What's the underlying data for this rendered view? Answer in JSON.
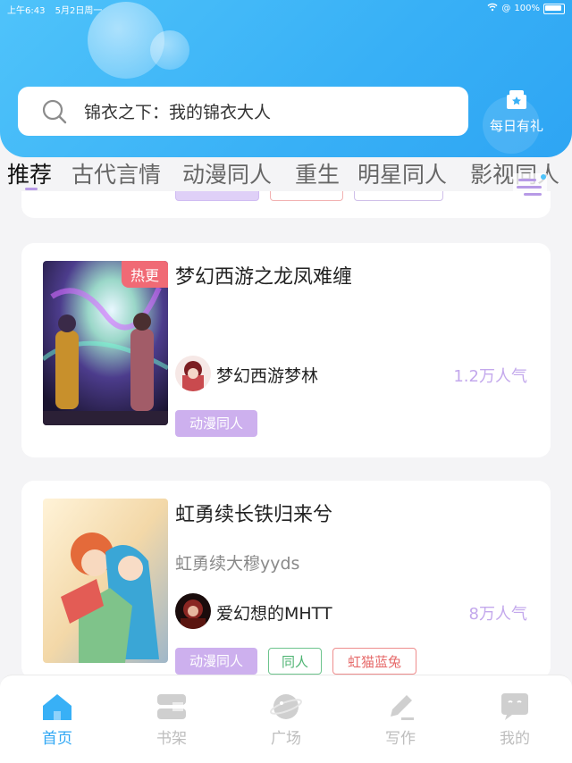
{
  "status_bar": {
    "time": "上午6:43",
    "date": "5月2日周一",
    "battery": "100%"
  },
  "search": {
    "text": "锦衣之下：我的锦衣大人"
  },
  "daily_gift": {
    "label": "每日有礼"
  },
  "tabs": [
    {
      "label": "推荐",
      "active": true
    },
    {
      "label": "古代言情"
    },
    {
      "label": "动漫同人"
    },
    {
      "label": "重生"
    },
    {
      "label": "明星同人"
    },
    {
      "label": "影视同人"
    }
  ],
  "cards": [
    {
      "badge": "热更",
      "title": "梦幻西游之龙凤难缠",
      "author": "梦幻西游梦林",
      "popularity": "1.2万人气",
      "tags": [
        "动漫同人"
      ]
    },
    {
      "title": "虹勇续长铁归来兮",
      "subtitle": "虹勇续大穆yyds",
      "author": "爱幻想的MHTT",
      "popularity": "8万人气",
      "tags": [
        "动漫同人",
        "同人",
        "虹猫蓝兔"
      ]
    }
  ],
  "nav": [
    {
      "label": "首页",
      "icon": "home-icon",
      "active": true
    },
    {
      "label": "书架",
      "icon": "bookshelf-icon"
    },
    {
      "label": "广场",
      "icon": "planet-icon"
    },
    {
      "label": "写作",
      "icon": "pen-icon"
    },
    {
      "label": "我的",
      "icon": "chat-face-icon"
    }
  ],
  "colors": {
    "header": "#38b0f6",
    "accent_purple": "#c3a8ec",
    "nav_active": "#2fa7f4",
    "hot_badge": "#f06a75"
  }
}
